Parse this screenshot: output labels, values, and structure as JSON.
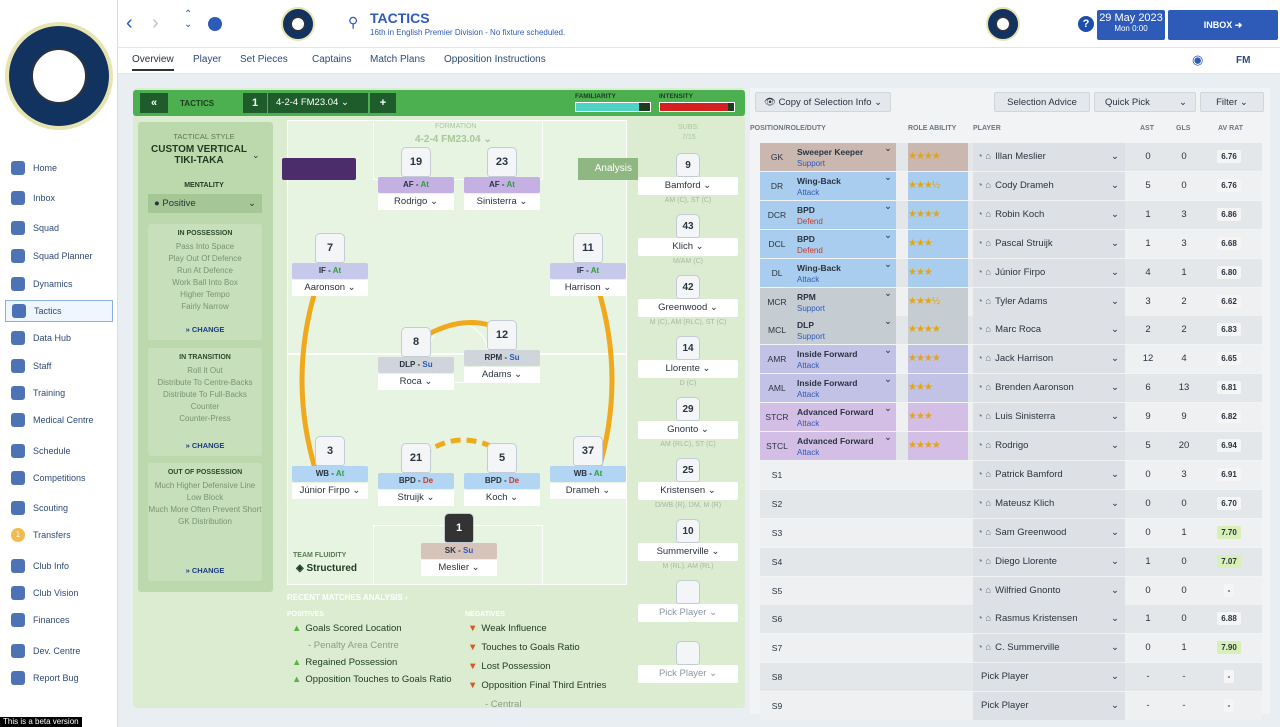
{
  "app": {
    "title": "TACTICS",
    "subtitle": "16th in English Premier Division - No fixture scheduled.",
    "date": "29 May 2023",
    "time": "Mon 0:00",
    "inbox": "INBOX",
    "brand": "FM",
    "beta": "This is a beta version"
  },
  "tabs": [
    "Overview",
    "Player",
    "Set Pieces",
    "Captains",
    "Match Plans",
    "Opposition Instructions"
  ],
  "sidebar": [
    {
      "label": "Home",
      "icon": "home-icon"
    },
    {
      "label": "Inbox",
      "icon": "inbox-icon"
    },
    {
      "label": "Squad",
      "icon": "squad-icon"
    },
    {
      "label": "Squad Planner",
      "icon": "planner-icon"
    },
    {
      "label": "Dynamics",
      "icon": "dynamics-icon"
    },
    {
      "label": "Tactics",
      "icon": "tactics-icon"
    },
    {
      "label": "Data Hub",
      "icon": "datahub-icon"
    },
    {
      "label": "Staff",
      "icon": "staff-icon"
    },
    {
      "label": "Training",
      "icon": "training-icon"
    },
    {
      "label": "Medical Centre",
      "icon": "medical-icon"
    },
    {
      "label": "Schedule",
      "icon": "schedule-icon"
    },
    {
      "label": "Competitions",
      "icon": "trophy-icon"
    },
    {
      "label": "Scouting",
      "icon": "scouting-icon"
    },
    {
      "label": "Transfers",
      "icon": "transfers-icon",
      "badge": "1"
    },
    {
      "label": "Club Info",
      "icon": "clubinfo-icon"
    },
    {
      "label": "Club Vision",
      "icon": "vision-icon"
    },
    {
      "label": "Finances",
      "icon": "finances-icon"
    },
    {
      "label": "Dev. Centre",
      "icon": "devcentre-icon"
    },
    {
      "label": "Report Bug",
      "icon": "bug-icon"
    }
  ],
  "tactic": {
    "header": "TACTICS",
    "slot": "1",
    "formation": "4-2-4 FM23.04",
    "familiarity": "FAMILIARITY",
    "intensity": "INTENSITY",
    "familiarity_level": 0.85,
    "intensity_level": 0.92,
    "style_label": "TACTICAL STYLE",
    "style": "CUSTOM VERTICAL TIKI-TAKA",
    "mentality_label": "MENTALITY",
    "mentality": "Positive",
    "formation_label": "FORMATION",
    "formation_name": "4-2-4 FM23.04",
    "subs_label": "SUBS:",
    "subs": "7/15",
    "analysis": "Analysis",
    "fluidity_label": "TEAM FLUIDITY",
    "fluidity": "Structured"
  },
  "phases": [
    {
      "title": "IN POSSESSION",
      "items": [
        "Pass Into Space",
        "Play Out Of Defence",
        "Run At Defence",
        "Work Ball Into Box",
        "Higher Tempo",
        "Fairly Narrow"
      ],
      "change": "CHANGE"
    },
    {
      "title": "IN TRANSITION",
      "items": [
        "Roll It Out",
        "Distribute To Centre-Backs",
        "Distribute To Full-Backs",
        "Counter",
        "Counter-Press"
      ],
      "change": "CHANGE"
    },
    {
      "title": "OUT OF POSSESSION",
      "items": [
        "Much Higher Defensive Line",
        "Low Block",
        "Much More Often Prevent Short GK Distribution"
      ],
      "change": "CHANGE"
    }
  ],
  "players": [
    {
      "no": "19",
      "role": "AF",
      "duty": "At",
      "name": "Rodrigo"
    },
    {
      "no": "23",
      "role": "AF",
      "duty": "At",
      "name": "Sinisterra"
    },
    {
      "no": "7",
      "role": "IF",
      "duty": "At",
      "name": "Aaronson"
    },
    {
      "no": "11",
      "role": "IF",
      "duty": "At",
      "name": "Harrison"
    },
    {
      "no": "8",
      "role": "DLP",
      "duty": "Su",
      "name": "Roca"
    },
    {
      "no": "12",
      "role": "RPM",
      "duty": "Su",
      "name": "Adams"
    },
    {
      "no": "3",
      "role": "WB",
      "duty": "At",
      "name": "Júnior Firpo"
    },
    {
      "no": "21",
      "role": "BPD",
      "duty": "De",
      "name": "Struijk"
    },
    {
      "no": "5",
      "role": "BPD",
      "duty": "De",
      "name": "Koch"
    },
    {
      "no": "37",
      "role": "WB",
      "duty": "At",
      "name": "Drameh"
    },
    {
      "no": "1",
      "role": "SK",
      "duty": "Su",
      "name": "Meslier"
    }
  ],
  "subs": [
    {
      "no": "9",
      "name": "Bamford",
      "pos": "AM (C), ST (C)"
    },
    {
      "no": "43",
      "name": "Klich",
      "pos": "M/AM (C)"
    },
    {
      "no": "42",
      "name": "Greenwood",
      "pos": "M (C), AM (RLC), ST (C)"
    },
    {
      "no": "14",
      "name": "Llorente",
      "pos": "D (C)"
    },
    {
      "no": "29",
      "name": "Gnonto",
      "pos": "AM (RLC), ST (C)"
    },
    {
      "no": "25",
      "name": "Kristensen",
      "pos": "D/WB (R), DM, M (R)"
    },
    {
      "no": "10",
      "name": "Summerville",
      "pos": "M (RL), AM (RL)"
    },
    {
      "no": "",
      "name": "Pick Player",
      "pos": ""
    },
    {
      "no": "",
      "name": "Pick Player",
      "pos": ""
    }
  ],
  "analysis": {
    "title": "RECENT MATCHES ANALYSIS",
    "pos_label": "POSITIVES",
    "neg_label": "NEGATIVES",
    "positives": [
      "Goals Scored Location",
      "- Penalty Area Centre",
      "Regained Possession",
      "Opposition Touches to Goals Ratio"
    ],
    "negatives": [
      "Weak Influence",
      "Touches to Goals Ratio",
      "Lost Possession",
      "Opposition Final Third Entries",
      "- Central"
    ]
  },
  "right": {
    "copy": "Copy of Selection Info",
    "advice": "Selection Advice",
    "quick": "Quick Pick",
    "filter": "Filter",
    "cols": [
      "POSITION/ROLE/DUTY",
      "ROLE ABILITY",
      "PLAYER",
      "AST",
      "GLS",
      "AV RAT"
    ]
  },
  "rows": [
    {
      "pos": "GK",
      "role": "Sweeper Keeper",
      "duty": "Support",
      "stars": 4,
      "player": "Illan Meslier",
      "ast": "0",
      "gls": "0",
      "rat": "6.76",
      "col": "#c9b7b0"
    },
    {
      "pos": "DR",
      "role": "Wing-Back",
      "duty": "Attack",
      "stars": 3.5,
      "player": "Cody Drameh",
      "ast": "5",
      "gls": "0",
      "rat": "6.76",
      "col": "#a9cdee"
    },
    {
      "pos": "DCR",
      "role": "BPD",
      "duty": "Defend",
      "stars": 4,
      "player": "Robin Koch",
      "ast": "1",
      "gls": "3",
      "rat": "6.86",
      "col": "#a9cdee"
    },
    {
      "pos": "DCL",
      "role": "BPD",
      "duty": "Defend",
      "stars": 3,
      "player": "Pascal Struijk",
      "ast": "1",
      "gls": "3",
      "rat": "6.68",
      "col": "#a9cdee"
    },
    {
      "pos": "DL",
      "role": "Wing-Back",
      "duty": "Attack",
      "stars": 3,
      "player": "Júnior Firpo",
      "ast": "4",
      "gls": "1",
      "rat": "6.80",
      "col": "#a9cdee"
    },
    {
      "pos": "MCR",
      "role": "RPM",
      "duty": "Support",
      "stars": 3.5,
      "player": "Tyler Adams",
      "ast": "3",
      "gls": "2",
      "rat": "6.62",
      "col": "#c5ccd2"
    },
    {
      "pos": "MCL",
      "role": "DLP",
      "duty": "Support",
      "stars": 4,
      "player": "Marc Roca",
      "ast": "2",
      "gls": "2",
      "rat": "6.83",
      "col": "#c5ccd2"
    },
    {
      "pos": "AMR",
      "role": "Inside Forward",
      "duty": "Attack",
      "stars": 4,
      "player": "Jack Harrison",
      "ast": "12",
      "gls": "4",
      "rat": "6.65",
      "col": "#c2c1e6"
    },
    {
      "pos": "AML",
      "role": "Inside Forward",
      "duty": "Attack",
      "stars": 3,
      "player": "Brenden Aaronson",
      "ast": "6",
      "gls": "13",
      "rat": "6.81",
      "col": "#c2c1e6"
    },
    {
      "pos": "STCR",
      "role": "Advanced Forward",
      "duty": "Attack",
      "stars": 3,
      "player": "Luis Sinisterra",
      "ast": "9",
      "gls": "9",
      "rat": "6.82",
      "col": "#d3bfe6"
    },
    {
      "pos": "STCL",
      "role": "Advanced Forward",
      "duty": "Attack",
      "stars": 4,
      "player": "Rodrigo",
      "ast": "5",
      "gls": "20",
      "rat": "6.94",
      "col": "#d3bfe6"
    },
    {
      "pos": "S1",
      "role": "",
      "duty": "",
      "stars": 0,
      "player": "Patrick Bamford",
      "ast": "0",
      "gls": "3",
      "rat": "6.91",
      "col": ""
    },
    {
      "pos": "S2",
      "role": "",
      "duty": "",
      "stars": 0,
      "player": "Mateusz Klich",
      "ast": "0",
      "gls": "0",
      "rat": "6.70",
      "col": ""
    },
    {
      "pos": "S3",
      "role": "",
      "duty": "",
      "stars": 0,
      "player": "Sam Greenwood",
      "ast": "0",
      "gls": "1",
      "rat": "7.70",
      "col": ""
    },
    {
      "pos": "S4",
      "role": "",
      "duty": "",
      "stars": 0,
      "player": "Diego Llorente",
      "ast": "1",
      "gls": "0",
      "rat": "7.07",
      "col": ""
    },
    {
      "pos": "S5",
      "role": "",
      "duty": "",
      "stars": 0,
      "player": "Wilfried Gnonto",
      "ast": "0",
      "gls": "0",
      "rat": "-",
      "col": ""
    },
    {
      "pos": "S6",
      "role": "",
      "duty": "",
      "stars": 0,
      "player": "Rasmus Kristensen",
      "ast": "1",
      "gls": "0",
      "rat": "6.88",
      "col": ""
    },
    {
      "pos": "S7",
      "role": "",
      "duty": "",
      "stars": 0,
      "player": "C. Summerville",
      "ast": "0",
      "gls": "1",
      "rat": "7.90",
      "col": ""
    },
    {
      "pos": "S8",
      "role": "",
      "duty": "",
      "stars": 0,
      "player": "Pick Player",
      "ast": "-",
      "gls": "-",
      "rat": "-",
      "col": ""
    },
    {
      "pos": "S9",
      "role": "",
      "duty": "",
      "stars": 0,
      "player": "Pick Player",
      "ast": "-",
      "gls": "-",
      "rat": "-",
      "col": ""
    }
  ]
}
